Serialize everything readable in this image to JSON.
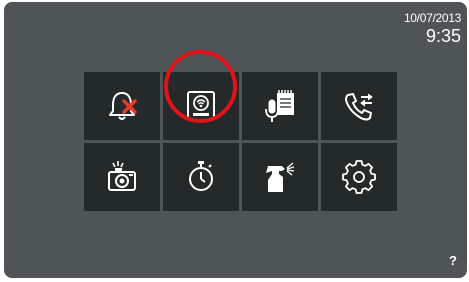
{
  "status": {
    "date": "10/07/2013",
    "time": "9:35"
  },
  "help": {
    "label": "?"
  },
  "menu": {
    "tiles": [
      {
        "name": "mute-ringer-tile",
        "icon": "bell-mute-icon"
      },
      {
        "name": "intercom-panel-tile",
        "icon": "door-panel-camera-icon",
        "highlighted": true
      },
      {
        "name": "voice-memo-tile",
        "icon": "microphone-notepad-icon"
      },
      {
        "name": "call-forward-tile",
        "icon": "phone-transfer-icon"
      },
      {
        "name": "photo-memory-tile",
        "icon": "camera-flash-icon"
      },
      {
        "name": "timer-tile",
        "icon": "stopwatch-icon"
      },
      {
        "name": "cleaning-mode-tile",
        "icon": "spray-bottle-icon"
      },
      {
        "name": "settings-tile",
        "icon": "gear-icon"
      }
    ]
  },
  "colors": {
    "background": "#4f5457",
    "tile": "#24292a",
    "icon": "#ffffff",
    "highlight": "#e0131b",
    "mute_cross": "#e63a2a"
  }
}
